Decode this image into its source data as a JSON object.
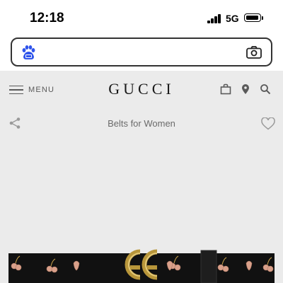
{
  "status_bar": {
    "time": "12:18",
    "network": "5G",
    "signal_bars": 4
  },
  "browser": {
    "search_placeholder": "",
    "search_icon": "baidu-paw-icon",
    "camera_icon": "camera-icon"
  },
  "site": {
    "menu_label": "MENU",
    "logo": "GUCCI",
    "icons": [
      "bag-icon",
      "location-pin-icon",
      "search-icon"
    ]
  },
  "page": {
    "title": "Belts for Women",
    "share_icon": "share-icon",
    "favorite_icon": "heart-icon"
  },
  "colors": {
    "background": "#ebebeb",
    "text_muted": "#6a6a6a",
    "logo": "#1a1a1a",
    "belt": "#111111",
    "buckle_gold": "#b8963a",
    "cherry_pink": "#d9a08a"
  }
}
